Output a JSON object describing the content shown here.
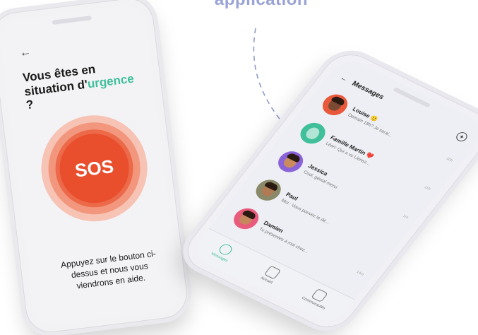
{
  "headline": "application",
  "sos_screen": {
    "back_icon": "arrow-left-icon",
    "title_prefix": "Vous êtes en situation d'",
    "title_accent": "urgence",
    "title_suffix": " ?",
    "sos_label": "SOS",
    "help_text": "Appuyez sur le bouton ci-dessus et nous vous viendrons en aide.",
    "colors": {
      "accent": "#3fbf9a",
      "sos": "#e94e2d"
    }
  },
  "messages_screen": {
    "title": "Messages",
    "back_icon": "arrow-left-icon",
    "add_icon": "plus-circle-icon",
    "conversations": [
      {
        "name": "Louise 🙂",
        "preview": "Demain 18h? Je serai...",
        "time": "10h",
        "color": "#e9583b"
      },
      {
        "name": "Famille Martin ❤️",
        "preview": "Léon: Qui a vu Lienez...",
        "time": "11h",
        "color": "#3fbf9a"
      },
      {
        "name": "Jessica",
        "preview": "Cool, génial merci",
        "time": "1m",
        "color": "#8b63d9"
      },
      {
        "name": "Paul",
        "preview": "Moi : Vous pouvez le dé...",
        "time": "",
        "color": "#8a8a6a"
      },
      {
        "name": "Damien",
        "preview": "Tu présentes à moi chez...",
        "time": "14m",
        "color": "#e85b7d"
      }
    ],
    "tabs": [
      {
        "label": "Messages",
        "icon": "chat-icon"
      },
      {
        "label": "Accueil",
        "icon": "home-icon"
      },
      {
        "label": "Communautés",
        "icon": "community-icon"
      }
    ]
  }
}
